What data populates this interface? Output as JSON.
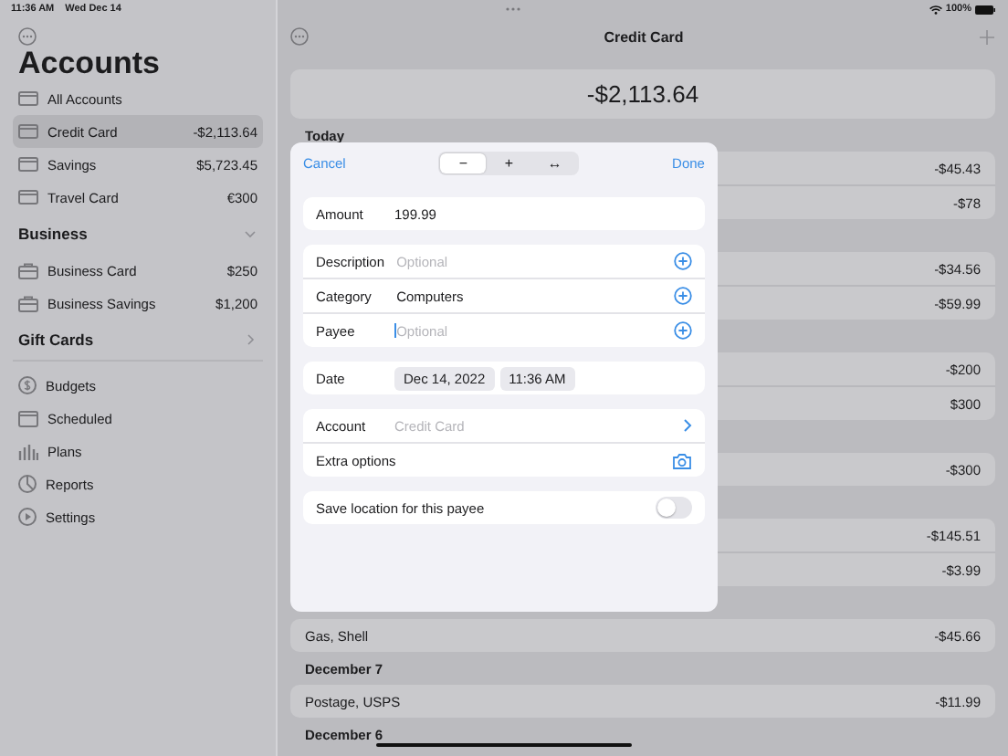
{
  "status_bar": {
    "time": "11:36 AM",
    "date": "Wed Dec 14",
    "battery": "100%"
  },
  "sidebar": {
    "title": "Accounts",
    "accounts": [
      {
        "name": "All Accounts",
        "selected": false
      },
      {
        "name": "Credit Card",
        "balance": "-$2,113.64",
        "selected": true
      },
      {
        "name": "Savings",
        "balance": "$5,723.45",
        "selected": false
      },
      {
        "name": "Travel Card",
        "balance": "€300",
        "selected": false
      }
    ],
    "sections": [
      {
        "title": "Business",
        "expanded": true,
        "items": [
          {
            "name": "Business Card",
            "balance": "$250"
          },
          {
            "name": "Business Savings",
            "balance": "$1,200"
          }
        ]
      },
      {
        "title": "Gift Cards",
        "expanded": false
      }
    ],
    "tools": [
      {
        "label": "Budgets",
        "kind": "budget"
      },
      {
        "label": "Scheduled",
        "kind": "calendar"
      },
      {
        "label": "Plans",
        "kind": "chart"
      },
      {
        "label": "Reports",
        "kind": "report"
      },
      {
        "label": "Settings",
        "kind": "settings"
      }
    ]
  },
  "main": {
    "title": "Credit Card",
    "balance": "-$2,113.64",
    "groups": [
      {
        "header": "Today",
        "rows": [
          {
            "amount": "-$45.43"
          },
          {
            "amount": "-$78"
          }
        ]
      },
      {
        "rows": [
          {
            "amount": "-$34.56"
          },
          {
            "amount": "-$59.99"
          }
        ]
      },
      {
        "rows": [
          {
            "amount": "-$200"
          },
          {
            "amount": "$300"
          }
        ]
      },
      {
        "rows": [
          {
            "amount": "-$300"
          }
        ]
      },
      {
        "rows": [
          {
            "amount": "-$145.51"
          },
          {
            "amount": "-$3.99"
          }
        ]
      },
      {
        "rows": [
          {
            "name": "Gas, Shell",
            "amount": "-$45.66"
          }
        ]
      },
      {
        "header": "December 7",
        "rows": [
          {
            "name": "Postage, USPS",
            "amount": "-$11.99"
          }
        ]
      },
      {
        "header": "December 6"
      }
    ]
  },
  "dialog": {
    "cancel": "Cancel",
    "done": "Done",
    "segments": [
      {
        "label": "−",
        "selected": true
      },
      {
        "label": "+",
        "selected": false
      },
      {
        "label": "↔",
        "selected": false
      }
    ],
    "amount": {
      "label": "Amount",
      "value": "199.99"
    },
    "fields": [
      {
        "label": "Description",
        "placeholder": "Optional",
        "focused": false
      },
      {
        "label": "Category",
        "value": "Computers",
        "focused": false
      },
      {
        "label": "Payee",
        "placeholder": "Optional",
        "focused": true
      }
    ],
    "date": {
      "label": "Date",
      "date": "Dec 14, 2022",
      "time": "11:36 AM"
    },
    "account": {
      "label": "Account",
      "value": "Credit Card"
    },
    "extra_options": {
      "label": "Extra options"
    },
    "save_location": {
      "label": "Save location for this payee",
      "on": false
    }
  }
}
